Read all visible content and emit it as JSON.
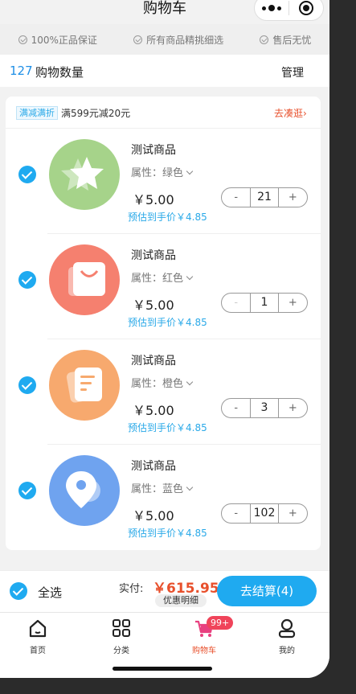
{
  "header": {
    "title": "购物车"
  },
  "guarantees": [
    "100%正品保证",
    "所有商品精挑细选",
    "售后无忧"
  ],
  "summary": {
    "count": "127",
    "count_label": "购物数量",
    "manage_label": "管理"
  },
  "promotion": {
    "tag": "满减满折",
    "text": "满599元减20元",
    "link": "去凑逛›"
  },
  "items": [
    {
      "name": "测试商品",
      "attr": "属性：绿色",
      "price": "￥5.00",
      "estimate": "预估到手价￥4.85",
      "quantity": "21",
      "minus": "-",
      "plus": "+",
      "minus_enabled": true,
      "icon": "star-icon",
      "color": "#a6d38a"
    },
    {
      "name": "测试商品",
      "attr": "属性：红色",
      "price": "￥5.00",
      "estimate": "预估到手价￥4.85",
      "quantity": "1",
      "minus": "-",
      "plus": "+",
      "minus_enabled": false,
      "icon": "shopping-bag-icon",
      "color": "#f5806f"
    },
    {
      "name": "测试商品",
      "attr": "属性：橙色",
      "price": "￥5.00",
      "estimate": "预估到手价￥4.85",
      "quantity": "3",
      "minus": "-",
      "plus": "+",
      "minus_enabled": true,
      "icon": "document-icon",
      "color": "#f7a96e"
    },
    {
      "name": "测试商品",
      "attr": "属性：蓝色",
      "price": "￥5.00",
      "estimate": "预估到手价￥4.85",
      "quantity": "102",
      "minus": "-",
      "plus": "+",
      "minus_enabled": true,
      "icon": "location-pin-icon",
      "color": "#6fa3ef"
    }
  ],
  "checkout": {
    "select_all": "全选",
    "total_label": "实付:",
    "total_value": "￥615.95",
    "discount_detail": "优惠明细",
    "button": "去结算(4)"
  },
  "tabbar": [
    {
      "label": "首页",
      "icon": "home-icon"
    },
    {
      "label": "分类",
      "icon": "grid-icon"
    },
    {
      "label": "购物车",
      "icon": "cart-icon",
      "badge": "99+",
      "active": true
    },
    {
      "label": "我的",
      "icon": "user-icon"
    }
  ],
  "colors": {
    "accent": "#1faaf0",
    "price_red": "#e8502c",
    "badge": "#f0445a"
  }
}
